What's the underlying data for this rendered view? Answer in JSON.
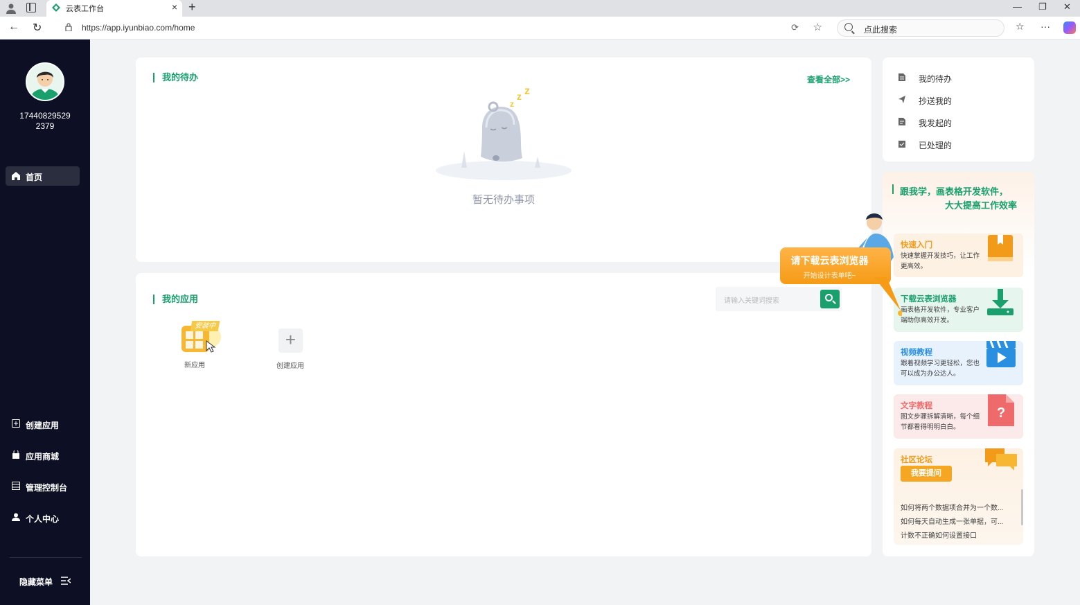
{
  "browser": {
    "tab_title": "云表工作台",
    "url": "https://app.iyunbiao.com/home",
    "search_placeholder": "点此搜索"
  },
  "sidebar": {
    "user_id_line1": "17440829529",
    "user_id_line2": "2379",
    "home_label": "首页",
    "items": [
      {
        "label": "创建应用",
        "icon": "app-add-icon"
      },
      {
        "label": "应用商城",
        "icon": "store-icon"
      },
      {
        "label": "管理控制台",
        "icon": "console-icon"
      },
      {
        "label": "个人中心",
        "icon": "user-icon"
      }
    ],
    "hide_menu_label": "隐藏菜单"
  },
  "todo": {
    "title": "我的待办",
    "view_all": "查看全部>>",
    "empty_text": "暂无待办事项"
  },
  "apps": {
    "title": "我的应用",
    "search_placeholder": "请输入关键词搜索",
    "installing_badge": "安装中",
    "items": [
      {
        "label": "新应用"
      },
      {
        "label": "创建应用"
      }
    ]
  },
  "quick_links": [
    {
      "label": "我的待办",
      "icon": "todo-doc-icon"
    },
    {
      "label": "抄送我的",
      "icon": "send-icon"
    },
    {
      "label": "我发起的",
      "icon": "initiated-doc-icon"
    },
    {
      "label": "已处理的",
      "icon": "processed-icon"
    }
  ],
  "promo": {
    "title_line1": "跟我学，画表格开发软件，",
    "title_line2": "大大提高工作效率",
    "download_bubble_title": "请下载云表浏览器",
    "download_bubble_sub": "开始设计表单吧~",
    "cards": [
      {
        "title": "快速入门",
        "desc": "快速掌握开发技巧，让工作更高效。",
        "color": "#f29a1a"
      },
      {
        "title": "下载云表浏览器",
        "desc": "画表格开发软件，专业客户端助你高效开发。",
        "color": "#1aa06d"
      },
      {
        "title": "视频教程",
        "desc": "跟着视频学习更轻松，您也可以成为办公达人。",
        "color": "#2a8fe0"
      },
      {
        "title": "文字教程",
        "desc": "图文步骤拆解清晰，每个细节都看得明明白白。",
        "color": "#ef6a6a"
      },
      {
        "title": "社区论坛",
        "desc": "",
        "color": "#f29a1a"
      }
    ],
    "ask_button": "我要提问",
    "forum_questions": [
      "如何将两个数据项合并为一个数...",
      "如何每天自动生成一张单据，可...",
      "计数不正确如何设置接口"
    ]
  },
  "colors": {
    "accent": "#1aa06d",
    "sidebar_bg": "#0d1024",
    "page_bg": "#f2f3f5"
  }
}
